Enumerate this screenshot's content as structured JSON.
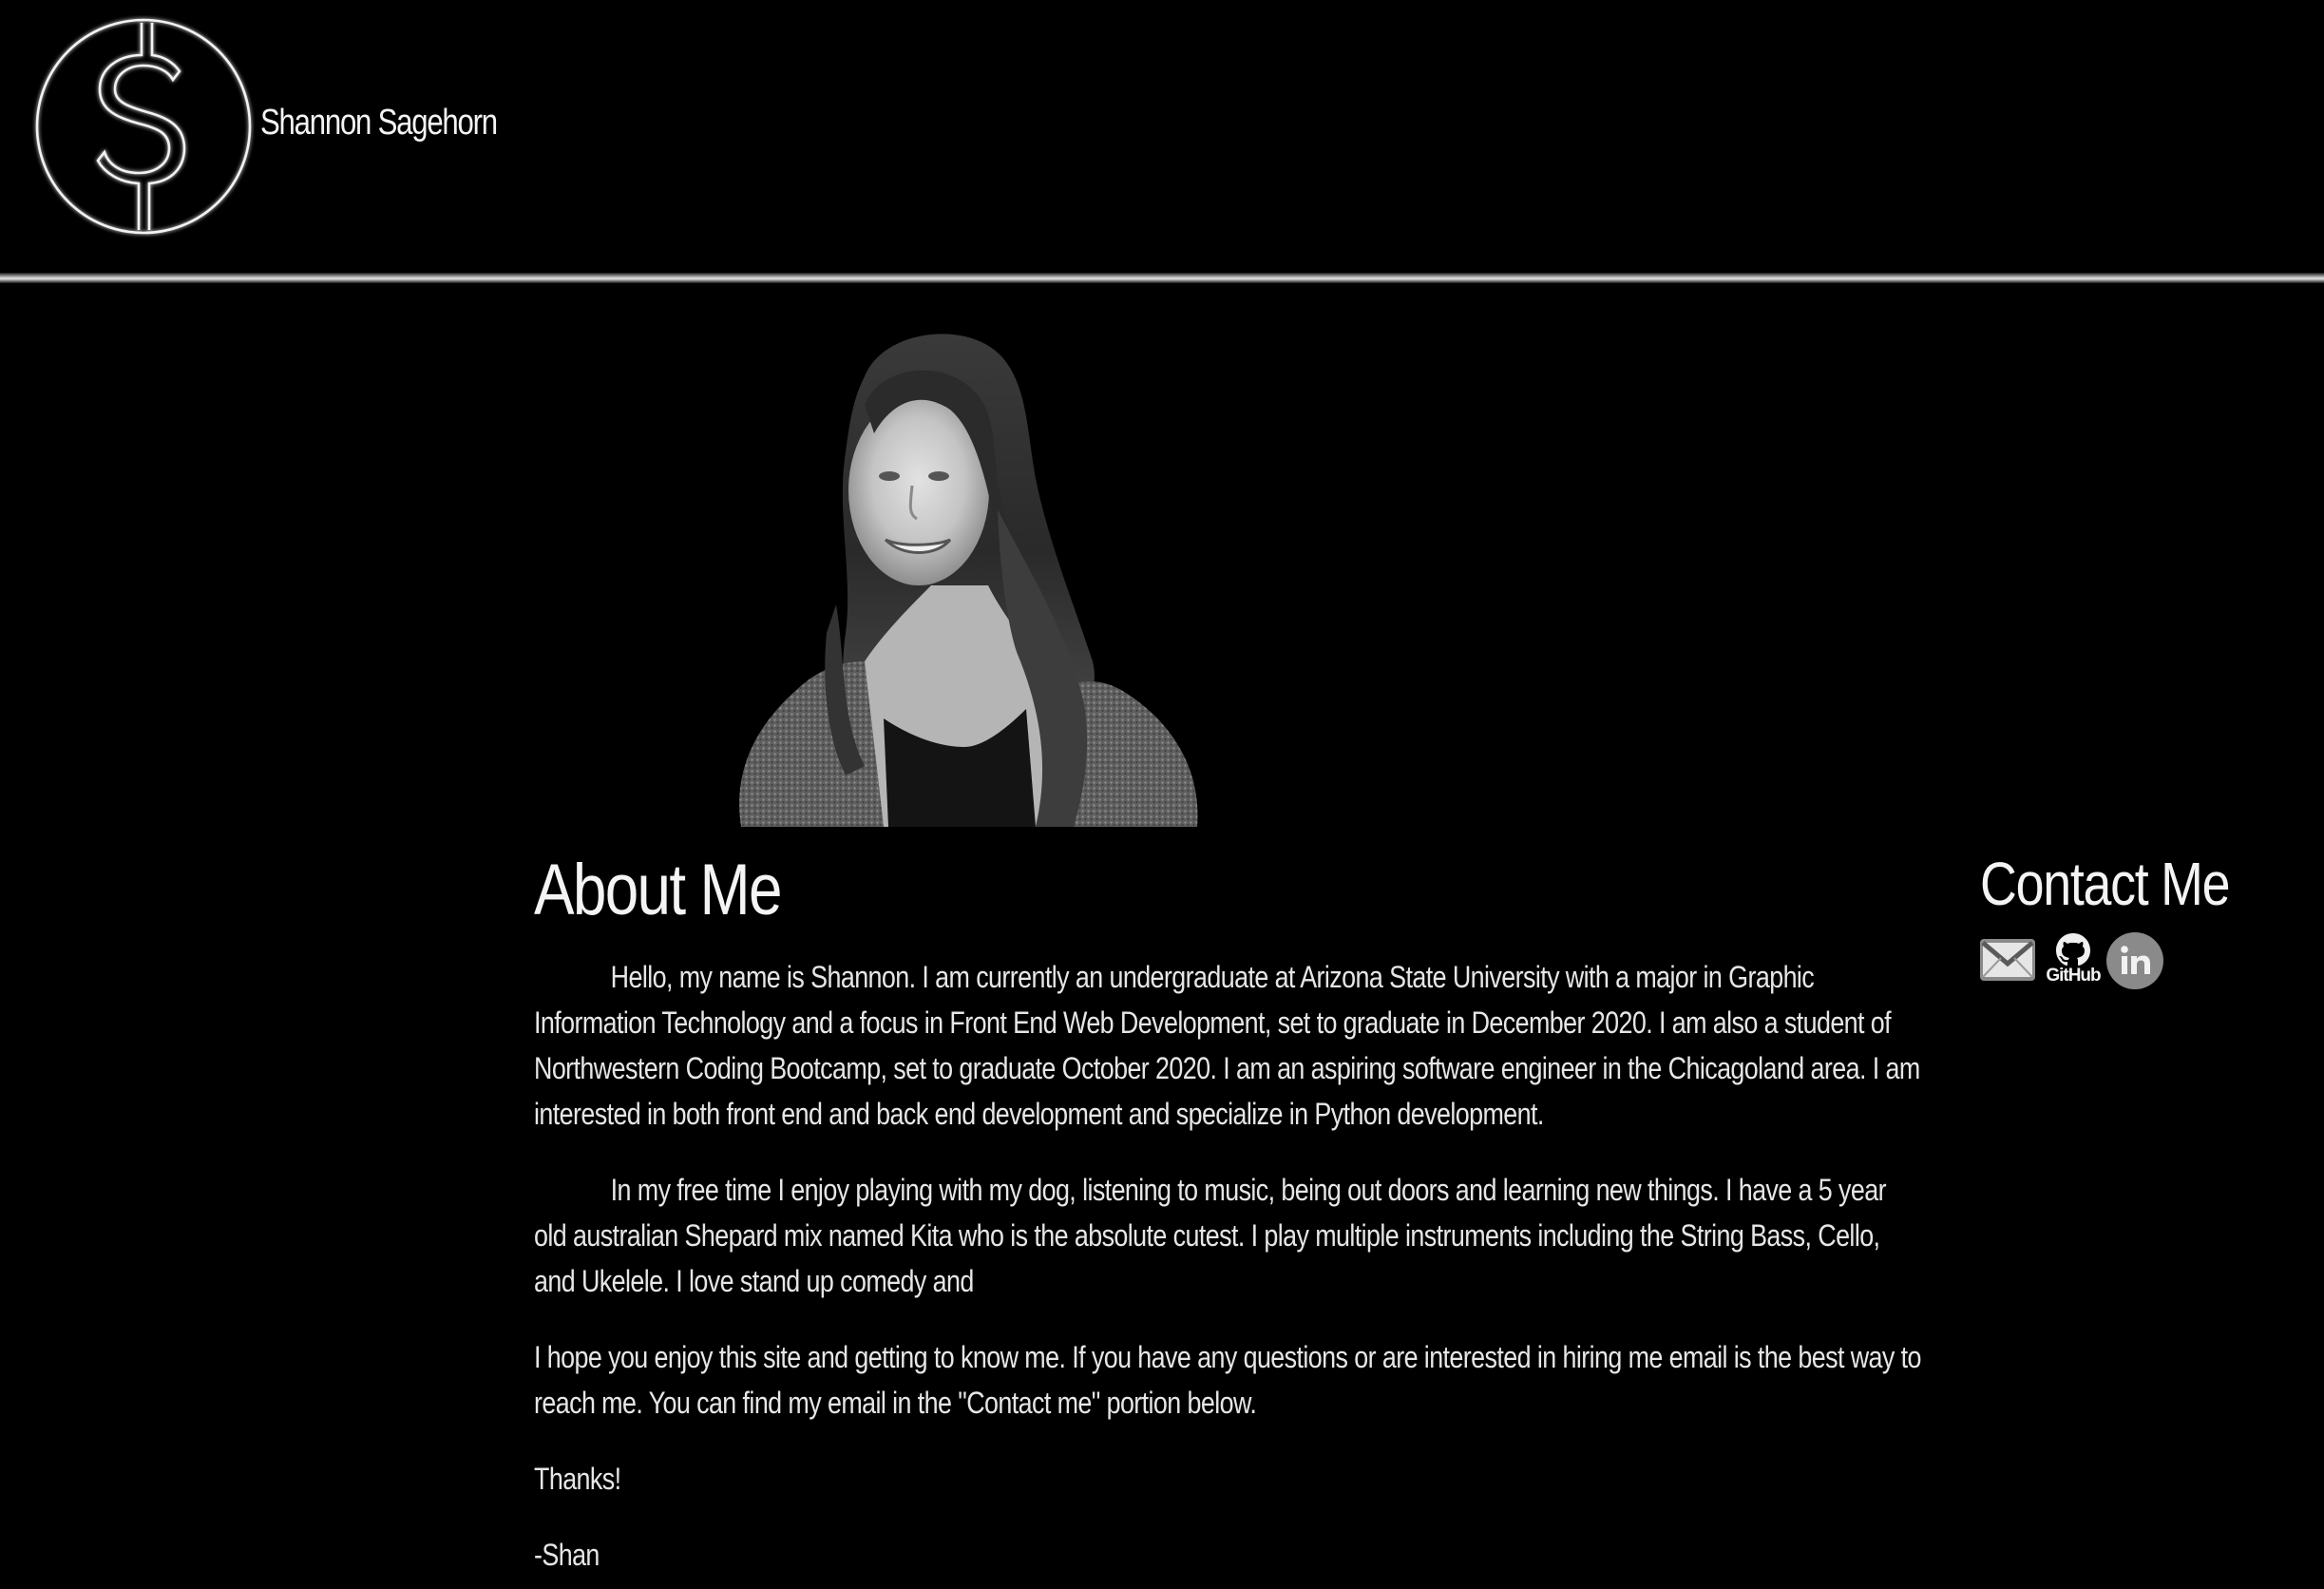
{
  "header": {
    "site_name": "Shannon Sagehorn",
    "logo_icon": "dollar-sign-circle-logo"
  },
  "portrait": {
    "description_icon": "profile-photo"
  },
  "about": {
    "title": "About Me",
    "paragraphs": [
      "Hello, my name is Shannon. I am currently an undergraduate at Arizona State University with a major in Graphic Information Technology and a focus in Front End Web Development, set to graduate in December 2020. I am also a student of Northwestern Coding Bootcamp, set to graduate October 2020. I am an aspiring software engineer in the Chicagoland area. I am interested in both front end and back end development and specialize in Python development.",
      "In my free time I enjoy playing with my dog, listening to music, being out doors and learning new things. I have a 5 year old australian Shepard mix named Kita who is the absolute cutest. I play multiple instruments including the String Bass, Cello, and Ukelele. I love stand up comedy and",
      "I hope you enjoy this site and getting to know me. If you have any questions or are interested in hiring me email is the best way to reach me. You can find my email in the \"Contact me\" portion below.",
      "Thanks!",
      "-Shan"
    ]
  },
  "contact": {
    "title": "Contact Me",
    "github_label": "GitHub",
    "icons": [
      "email-icon",
      "github-icon",
      "linkedin-icon"
    ]
  },
  "colors": {
    "background": "#000000",
    "text": "#f2f2f2",
    "icon_gray": "#8a8a8a"
  }
}
